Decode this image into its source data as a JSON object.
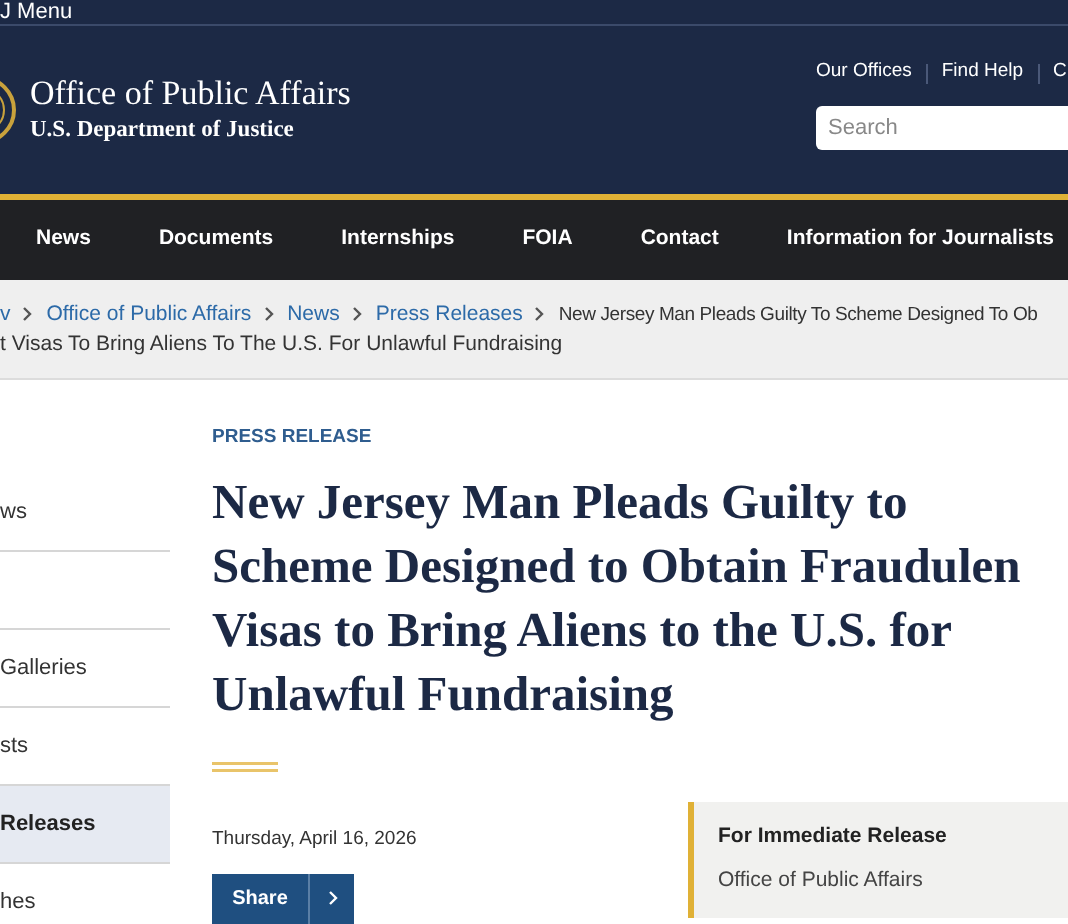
{
  "top_bar": {
    "menu_label": "J Menu"
  },
  "header": {
    "title": "Office of Public Affairs",
    "subtitle": "U.S. Department of Justice",
    "links": [
      "Our Offices",
      "Find Help",
      "C"
    ],
    "search": {
      "placeholder": "Search"
    }
  },
  "nav": [
    "News",
    "Documents",
    "Internships",
    "FOIA",
    "Contact",
    "Information for Journalists"
  ],
  "breadcrumb": {
    "items": [
      "v",
      "Office of Public Affairs",
      "News",
      "Press Releases"
    ],
    "current_lines": [
      "New Jersey Man Pleads Guilty To Scheme Designed To Ob",
      "t Visas To Bring Aliens To The U.S. For Unlawful Fundraising"
    ]
  },
  "sidebar": {
    "items": [
      {
        "label": "ws",
        "selected": false
      },
      {
        "selected": false
      },
      {
        "label": "Galleries",
        "selected": false
      },
      {
        "label": "sts",
        "selected": false
      },
      {
        "label": "Releases",
        "selected": true
      },
      {
        "label": "hes",
        "selected": false
      }
    ]
  },
  "article": {
    "eyebrow": "PRESS RELEASE",
    "title_lines": [
      "New Jersey Man Pleads Guilty to",
      "Scheme Designed to Obtain Fraudulen",
      "Visas to Bring Aliens to the U.S. for",
      "Unlawful Fundraising"
    ],
    "date": "Thursday, April 16, 2026",
    "share": "Share"
  },
  "release_box": {
    "heading": "For Immediate Release",
    "source": "Office of Public Affairs"
  }
}
